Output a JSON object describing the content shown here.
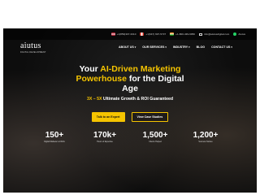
{
  "topbar": {
    "contacts": [
      {
        "flag": "us-flag",
        "colors": [
          "#b22234",
          "#ffffff"
        ],
        "text": "+1(859)307-3310"
      },
      {
        "flag": "canada-flag",
        "colors": [
          "#d52b1e",
          "#ffffff"
        ],
        "text": "+1(647) 697-5737"
      },
      {
        "flag": "india-flag",
        "colors": [
          "#ff9933",
          "#138808"
        ],
        "text": "+1-800-439-9950"
      }
    ],
    "email": "info@aiutusdigital.com",
    "whatsapp": "Aiutus"
  },
  "navbar": {
    "logo_text": "aiutus",
    "logo_tagline": "DIGITAL DEVELOPMENT",
    "items": [
      {
        "label": "ABOUT US",
        "dropdown": true
      },
      {
        "label": "OUR SERVICES",
        "dropdown": true
      },
      {
        "label": "INDUSTRY",
        "dropdown": true
      },
      {
        "label": "BLOG",
        "dropdown": false
      },
      {
        "label": "CONTACT US",
        "dropdown": true
      }
    ]
  },
  "hero": {
    "line1_plain": "Your ",
    "line1_highlight": "AI-Driven Marketing",
    "line2_highlight": "Powerhouse",
    "line2_plain": " for the Digital",
    "line3_plain": "Age",
    "tagline_highlight": "3X – 5X",
    "tagline_plain": " Ultimate Growth & ROI Guaranteed",
    "primary_button": "Talk to an Expert",
    "secondary_button": "View Case Studies"
  },
  "stats": [
    {
      "value": "150+",
      "label": "Digital Marketer at Work"
    },
    {
      "value": "170k+",
      "label": "Hours of Expertise"
    },
    {
      "value": "1,500+",
      "label": "Clients Helped"
    },
    {
      "value": "1,200+",
      "label": "Success Stories"
    }
  ],
  "colors": {
    "accent": "#f5c400",
    "background": "#0d0d0d",
    "text": "#ffffff"
  }
}
